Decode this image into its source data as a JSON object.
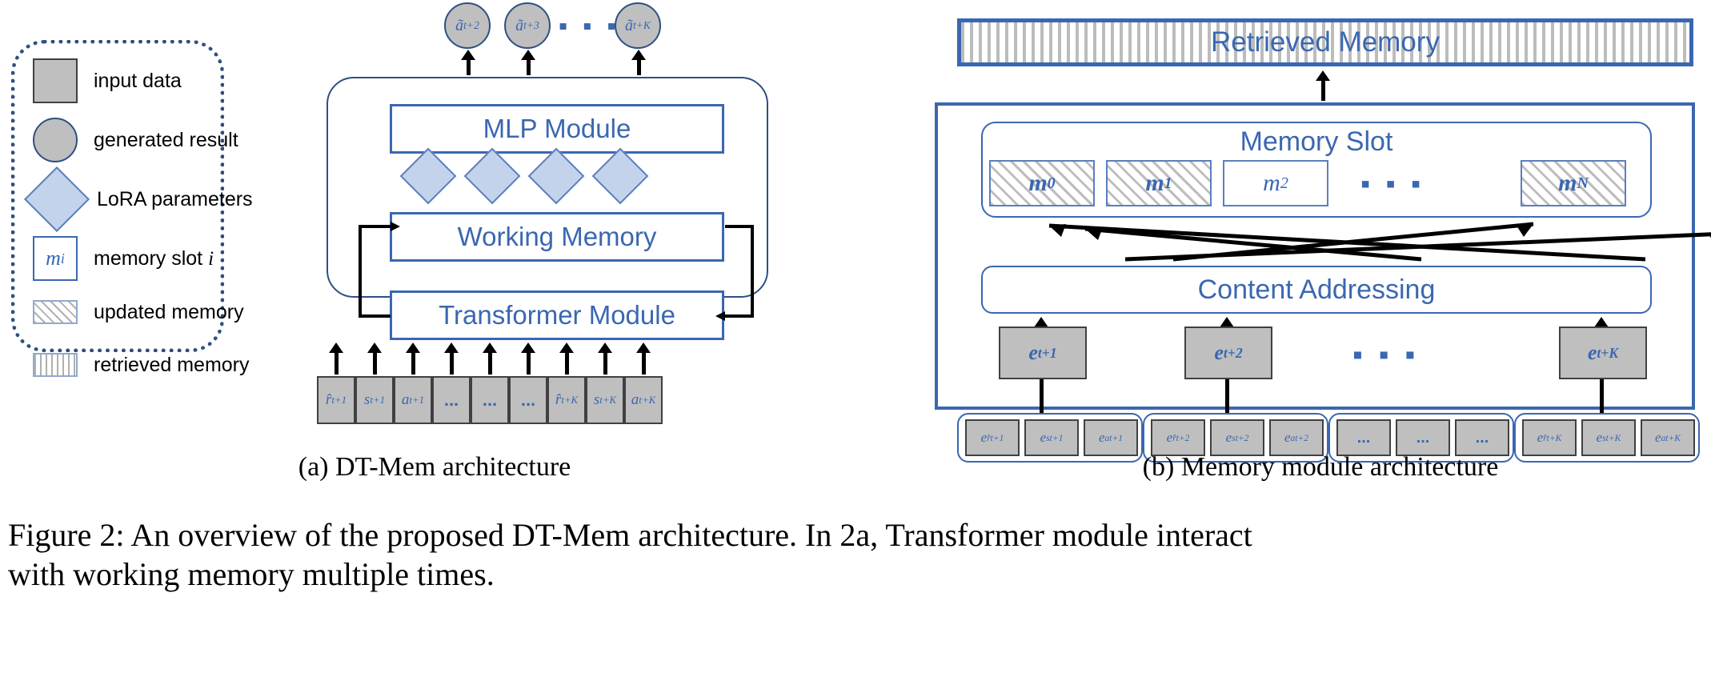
{
  "legend": {
    "items": [
      {
        "key": "input-data",
        "label": "input data",
        "swatch": "gray-square"
      },
      {
        "key": "generated-result",
        "label": "generated result",
        "swatch": "gray-circle"
      },
      {
        "key": "lora-parameters",
        "label": "LoRA parameters",
        "swatch": "blue-diamond"
      },
      {
        "key": "memory-slot",
        "label": "memory slot ",
        "label_italic": "i",
        "swatch": "memory-slot-box",
        "swatch_text": "m",
        "swatch_sub": "i"
      },
      {
        "key": "updated-memory",
        "label": "updated memory",
        "swatch": "diagonal-hatch"
      },
      {
        "key": "retrieved-memory",
        "label": "retrieved memory",
        "swatch": "vertical-hatch"
      }
    ]
  },
  "panel_a": {
    "caption": "(a) DT-Mem architecture",
    "outputs": [
      {
        "base": "ã",
        "sub": "t+2"
      },
      {
        "base": "ã",
        "sub": "t+3"
      },
      {
        "base": "ã",
        "sub": "t+K"
      }
    ],
    "output_ellipsis": "▪ ▪ ▪",
    "modules": [
      {
        "key": "mlp-module",
        "label": "MLP Module"
      },
      {
        "key": "working-memory",
        "label": "Working Memory"
      },
      {
        "key": "transformer-module",
        "label": "Transformer Module"
      }
    ],
    "lora_count": 4,
    "inputs": [
      {
        "base": "r̂",
        "sub": "t+1"
      },
      {
        "base": "s",
        "sub": "t+1"
      },
      {
        "base": "a",
        "sub": "t+1"
      },
      {
        "base": "...",
        "sub": ""
      },
      {
        "base": "...",
        "sub": ""
      },
      {
        "base": "...",
        "sub": ""
      },
      {
        "base": "r̂",
        "sub": "t+K"
      },
      {
        "base": "s",
        "sub": "t+K"
      },
      {
        "base": "a",
        "sub": "t+K"
      }
    ]
  },
  "panel_b": {
    "caption": "(b) Memory module architecture",
    "retrieved_memory_label": "Retrieved Memory",
    "memory_slot_title": "Memory Slot",
    "memory_slots": [
      {
        "base": "m",
        "sub": "0",
        "state": "updated"
      },
      {
        "base": "m",
        "sub": "1",
        "state": "updated"
      },
      {
        "base": "m",
        "sub": "2",
        "state": "plain"
      },
      {
        "base": "m",
        "sub": "N",
        "state": "updated"
      }
    ],
    "memory_slot_ellipsis": "▪ ▪ ▪",
    "content_addressing_label": "Content Addressing",
    "embeddings": [
      {
        "base": "e",
        "sub": "t+1"
      },
      {
        "base": "e",
        "sub": "t+2"
      },
      {
        "base": "e",
        "sub": "t+K"
      }
    ],
    "embeddings_ellipsis": "▪ ▪ ▪",
    "token_groups": [
      {
        "tokens": [
          {
            "base": "e",
            "sub": "r̂t+1"
          },
          {
            "base": "e",
            "sub": "st+1"
          },
          {
            "base": "e",
            "sub": "at+1"
          }
        ]
      },
      {
        "tokens": [
          {
            "base": "e",
            "sub": "r̂t+2"
          },
          {
            "base": "e",
            "sub": "st+2"
          },
          {
            "base": "e",
            "sub": "at+2"
          }
        ]
      },
      {
        "tokens": [
          {
            "base": "...",
            "sub": ""
          },
          {
            "base": "...",
            "sub": ""
          },
          {
            "base": "...",
            "sub": ""
          }
        ]
      },
      {
        "tokens": [
          {
            "base": "e",
            "sub": "r̂t+K"
          },
          {
            "base": "e",
            "sub": "st+K"
          },
          {
            "base": "e",
            "sub": "at+K"
          }
        ]
      }
    ]
  },
  "figure_caption": {
    "line1": "Figure 2: An overview of the proposed DT-Mem architecture. In 2a, Transformer module interact",
    "line2": "with working memory multiple times."
  },
  "colors": {
    "accent_blue": "#3a67b1",
    "outline_blue": "#2e4f82",
    "gray_fill": "#bfbfbf",
    "diamond_fill": "#c4d3ec"
  }
}
